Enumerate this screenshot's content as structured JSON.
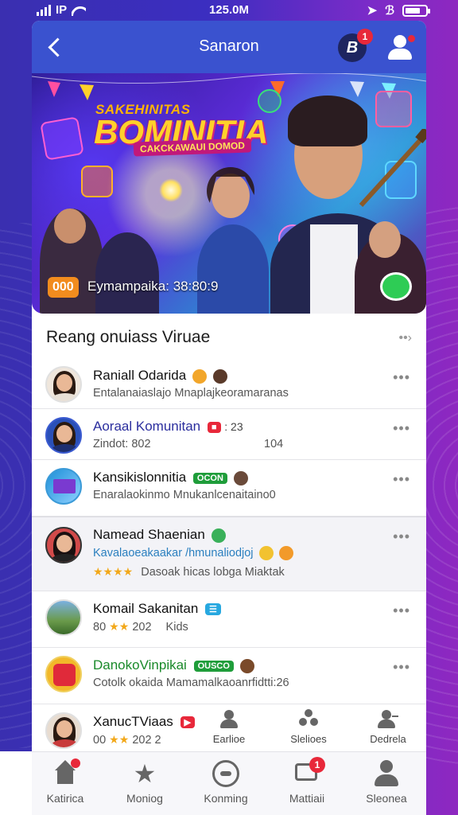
{
  "status_bar": {
    "carrier": "IP",
    "time": "125.0M"
  },
  "app_bar": {
    "title": "Sanaron",
    "app_badge_letter": "B",
    "app_badge_count": "1"
  },
  "banner": {
    "brand_top": "SAKEHINITAS",
    "brand_main": "BOMINITIA",
    "brand_sub": "CAKCKAWAUI DOMOD",
    "badge": "000",
    "caption": "Eymampaika: 38:80:9"
  },
  "section": {
    "title": "Reang onuiass Viruae",
    "more_icon": "chevron-right"
  },
  "list": [
    {
      "name": "Raniall Odarida",
      "sub": "Entalanaiaslajo Mnaplajkeoramaranas",
      "name_color": "#111111"
    },
    {
      "name": "Aoraal Komunitan",
      "tail": ": 23",
      "sub": "Zindot: 802",
      "sub_right": "104",
      "name_color": "#2b2e9e"
    },
    {
      "name": "Kansikislonnitia",
      "tag": "OCON",
      "sub": "Enaralaokinmo  Mnukanlcenaitaino0",
      "name_color": "#111111"
    },
    {
      "name": "Namead Shaenian",
      "sub": "Kavalaoeakaakar /hmunaliodjoj",
      "sub2": "Dasoak hicas lobga  Miaktak",
      "stars": "★★★★",
      "name_color": "#111111",
      "sub_color": "#2a7fbf"
    },
    {
      "name": "Komail Sakanitan",
      "sub": "80",
      "stars": "★★",
      "sub_mid": "202",
      "sub_right": "Kids",
      "name_color": "#111111"
    },
    {
      "name": "DanokoVinpikai",
      "tag": "OUSCO",
      "sub": "Cotolk okaida Mamamalkaoanrfidtti:26",
      "name_color": "#1a8a2a"
    },
    {
      "name": "XanucTViaas",
      "sub": "00",
      "stars": "★★",
      "sub_mid": "202",
      "sub_right": "2",
      "name_color": "#111111"
    }
  ],
  "actions": [
    {
      "label": "Earlioe",
      "icon": "person-icon"
    },
    {
      "label": "Slelioes",
      "icon": "group-icon"
    },
    {
      "label": "Dedrela",
      "icon": "user-add-icon"
    }
  ],
  "bottom_nav": [
    {
      "label": "Katirica",
      "icon": "home-icon",
      "badge": ""
    },
    {
      "label": "Moniog",
      "icon": "star-icon",
      "badge": ""
    },
    {
      "label": "Konming",
      "icon": "compass-icon",
      "badge": ""
    },
    {
      "label": "Mattiaii",
      "icon": "chat-icon",
      "badge": "1"
    },
    {
      "label": "Sleonea",
      "icon": "profile-icon",
      "badge": ""
    }
  ],
  "colors": {
    "app_bar": "#3a52cf",
    "badge_red": "#e8283a",
    "tag_green": "#1f9d3a",
    "banner_badge": "#f28c1e"
  }
}
